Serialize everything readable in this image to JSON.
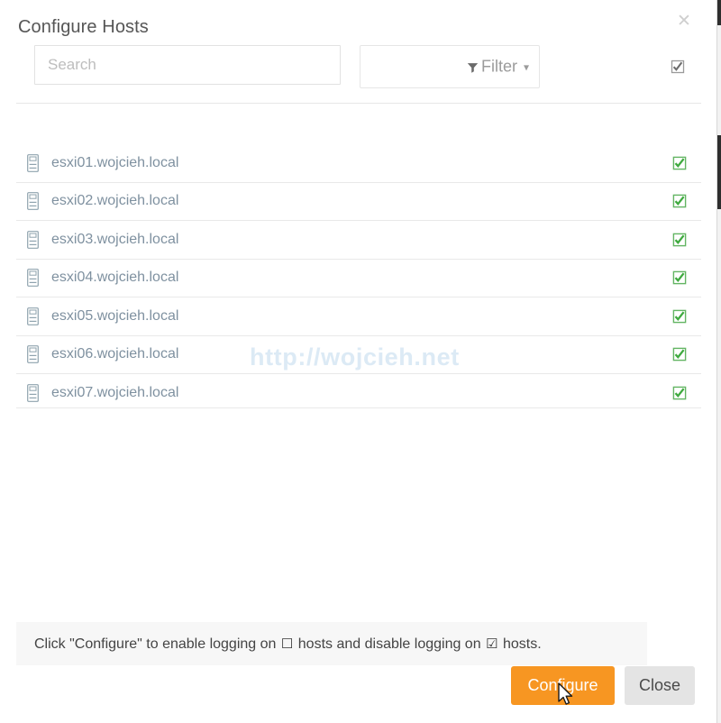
{
  "dialog": {
    "title": "Configure Hosts",
    "close_icon": "close-icon"
  },
  "toolbar": {
    "search": {
      "placeholder": "Search",
      "value": ""
    },
    "filter": {
      "label": "Filter",
      "icon": "funnel-icon",
      "chevron": "⌄"
    },
    "select_all_checked": true
  },
  "watermark": {
    "text": "http://wojcieh.net"
  },
  "hosts": [
    {
      "name": "esxi01.wojcieh.local",
      "checked": true
    },
    {
      "name": "esxi02.wojcieh.local",
      "checked": true
    },
    {
      "name": "esxi03.wojcieh.local",
      "checked": true
    },
    {
      "name": "esxi04.wojcieh.local",
      "checked": true
    },
    {
      "name": "esxi05.wojcieh.local",
      "checked": true
    },
    {
      "name": "esxi06.wojcieh.local",
      "checked": true
    },
    {
      "name": "esxi07.wojcieh.local",
      "checked": true
    }
  ],
  "footer": {
    "message_part1": "Click \"Configure\" to enable logging on",
    "unchecked_glyph": "☐",
    "message_part2": "hosts and disable logging on",
    "checked_glyph": "☑",
    "message_part3": "hosts."
  },
  "buttons": {
    "configure": "Configure",
    "close": "Close"
  },
  "colors": {
    "accent_orange": "#f79622",
    "check_green": "#3faa3f",
    "host_text": "#7f91a0",
    "watermark": "#dceaf5"
  }
}
